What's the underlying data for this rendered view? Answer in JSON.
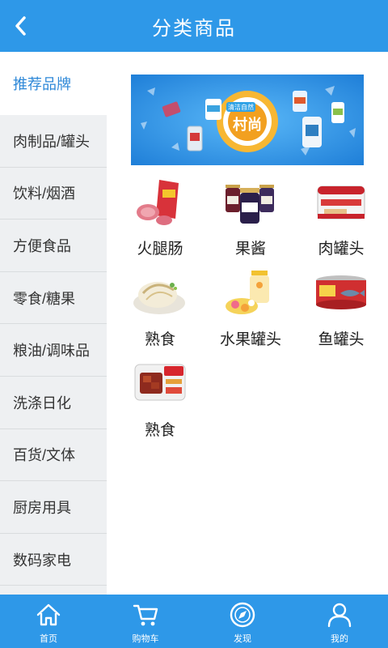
{
  "header": {
    "title": "分类商品",
    "back_icon": "chevron-left-icon"
  },
  "sidebar": {
    "items": [
      {
        "label": "推荐品牌",
        "active": true
      },
      {
        "label": "肉制品/罐头"
      },
      {
        "label": "饮料/烟酒"
      },
      {
        "label": "方便食品"
      },
      {
        "label": "零食/糖果"
      },
      {
        "label": "粮油/调味品"
      },
      {
        "label": "洗涤日化"
      },
      {
        "label": "百货/文体"
      },
      {
        "label": "厨房用具"
      },
      {
        "label": "数码家电"
      }
    ]
  },
  "banner": {
    "brand_text": "村尚",
    "tag_text": "清洁自然"
  },
  "products": [
    {
      "label": "火腿肠",
      "icon": "ham-sausage-image"
    },
    {
      "label": "果酱",
      "icon": "jam-jars-image"
    },
    {
      "label": "肉罐头",
      "icon": "meat-can-image"
    },
    {
      "label": "熟食",
      "icon": "cooked-chicken-image"
    },
    {
      "label": "水果罐头",
      "icon": "fruit-can-image"
    },
    {
      "label": "鱼罐头",
      "icon": "fish-can-image"
    },
    {
      "label": "熟食",
      "icon": "braised-pork-can-image"
    }
  ],
  "tabbar": {
    "items": [
      {
        "label": "首页",
        "icon": "home-icon"
      },
      {
        "label": "购物车",
        "icon": "cart-icon"
      },
      {
        "label": "发现",
        "icon": "compass-icon"
      },
      {
        "label": "我的",
        "icon": "user-icon"
      }
    ]
  },
  "colors": {
    "primary": "#2e98e8",
    "active_text": "#2e88d8",
    "sidebar_bg": "#eef0f2"
  }
}
